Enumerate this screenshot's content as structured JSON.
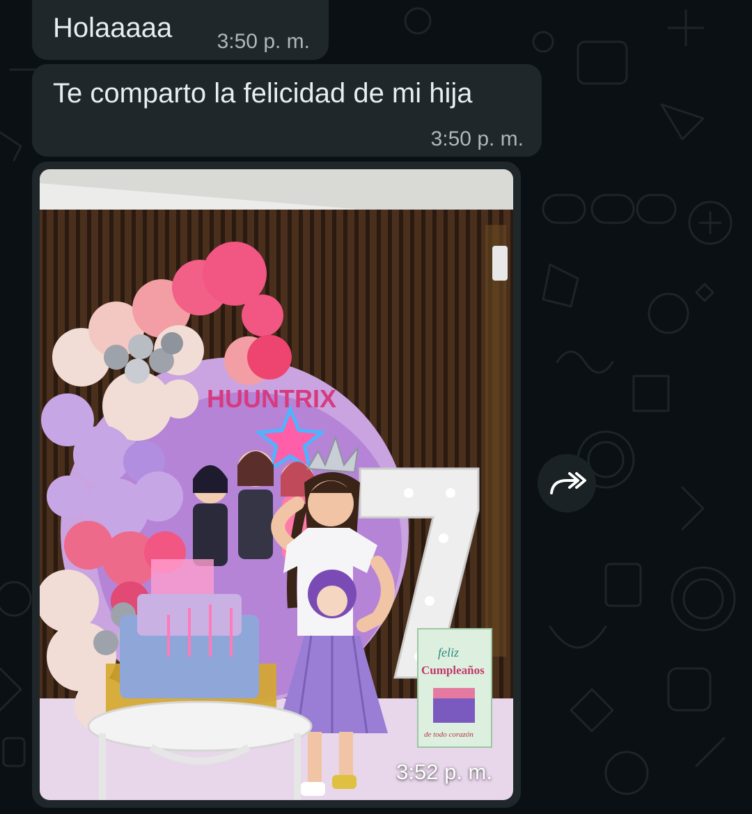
{
  "theme": {
    "background": "#0b1014",
    "bubble": "#1f272a",
    "text": "#e9edef",
    "meta": "#aeb7bc"
  },
  "messages": [
    {
      "text": "Holaaaaa",
      "time": "3:50 p. m."
    },
    {
      "text": "Te comparto la felicidad de mi hija",
      "time": "3:50 p. m."
    },
    {
      "image": "birthday-party-photo",
      "time": "3:52 p. m."
    }
  ],
  "photo": {
    "backdrop_title": "HUUNTRIX",
    "bag_text_1": "feliz",
    "bag_text_2": "Cumpleaños",
    "bag_text_3": "de todo corazón"
  },
  "icons": {
    "forward": "forward-icon"
  }
}
